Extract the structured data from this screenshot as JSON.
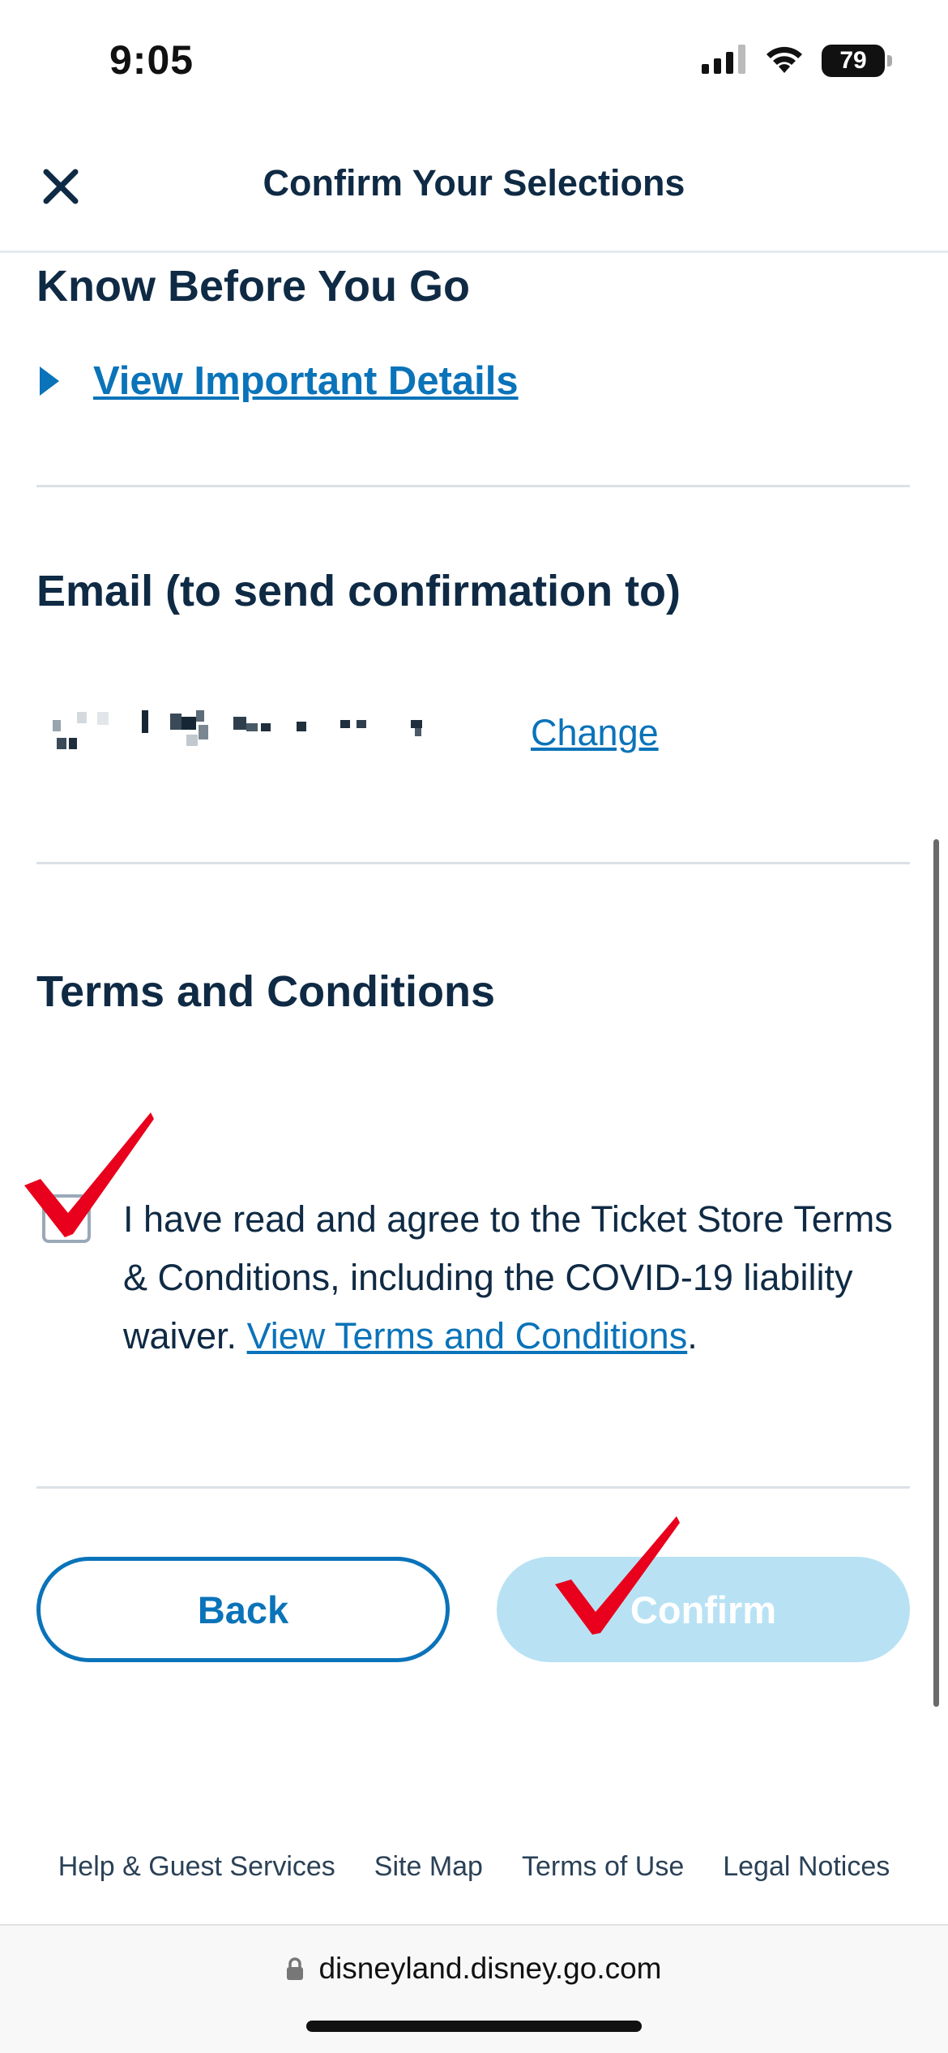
{
  "status_bar": {
    "time": "9:05",
    "battery": "79"
  },
  "header": {
    "title": "Confirm Your Selections"
  },
  "know_before": {
    "title": "Know Before You Go",
    "link_label": "View Important Details"
  },
  "email": {
    "title": "Email (to send confirmation to)",
    "change_label": "Change"
  },
  "terms": {
    "title": "Terms and Conditions",
    "agreement_text": "I have read and agree to the Ticket Store Terms & Conditions, including the COVID-19 liability waiver.",
    "link_label": "View Terms and Conditions",
    "trailing": ".",
    "checked": false
  },
  "buttons": {
    "back_label": "Back",
    "confirm_label": "Confirm"
  },
  "footer": {
    "links": [
      "Help & Guest Services",
      "Site Map",
      "Terms of Use",
      "Legal Notices"
    ]
  },
  "browser": {
    "url": "disneyland.disney.go.com"
  },
  "colors": {
    "accent": "#0a73b9",
    "text": "#0f2a44",
    "confirm_disabled": "#b8e2f4",
    "annotation_check": "#e8001c"
  }
}
